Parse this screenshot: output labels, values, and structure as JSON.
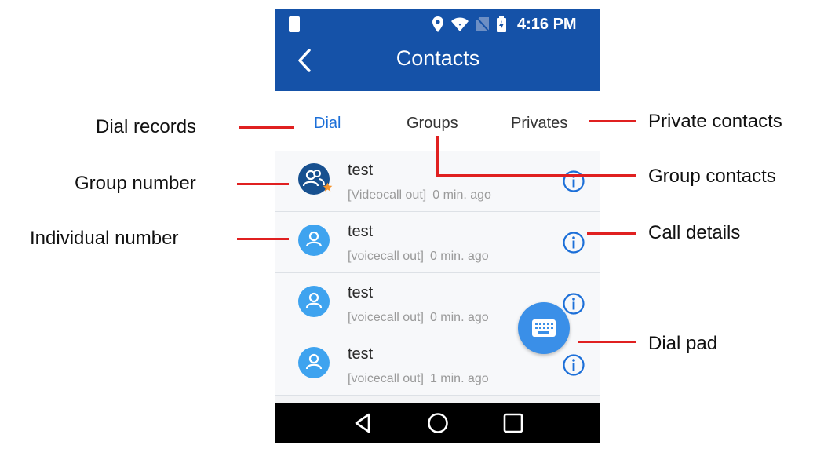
{
  "status_bar": {
    "time": "4:16 PM"
  },
  "header": {
    "title": "Contacts",
    "back_icon": "chevron-left-icon"
  },
  "tabs": [
    {
      "label": "Dial",
      "active": true
    },
    {
      "label": "Groups",
      "active": false
    },
    {
      "label": "Privates",
      "active": false
    }
  ],
  "records": [
    {
      "name": "test",
      "call_type": "[Videocall out]",
      "time": "0 min. ago",
      "avatar": "group"
    },
    {
      "name": "test",
      "call_type": "[voicecall out]",
      "time": "0 min. ago",
      "avatar": "individual"
    },
    {
      "name": "test",
      "call_type": "[voicecall out]",
      "time": "0 min. ago",
      "avatar": "individual"
    },
    {
      "name": "test",
      "call_type": "[voicecall out]",
      "time": "1 min. ago",
      "avatar": "individual"
    }
  ],
  "annotations": {
    "dial_records": "Dial records",
    "group_number": "Group number",
    "individual_number": "Individual number",
    "private_contacts": "Private contacts",
    "group_contacts": "Group contacts",
    "call_details": "Call details",
    "dial_pad": "Dial pad"
  },
  "colors": {
    "app_bar": "#1552a8",
    "accent": "#1c6fd8",
    "callout_line": "#e02020",
    "fab": "#3a8fe8"
  }
}
